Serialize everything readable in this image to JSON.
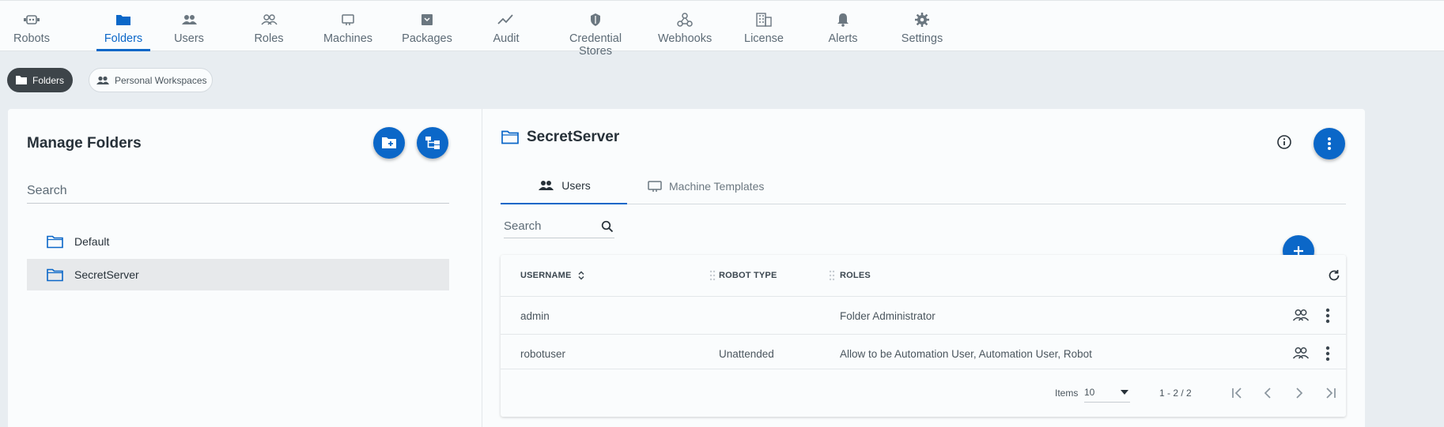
{
  "nav": [
    {
      "label": "Robots",
      "icon": "robot-icon"
    },
    {
      "label": "Folders",
      "icon": "folder-icon"
    },
    {
      "label": "Users",
      "icon": "users-icon"
    },
    {
      "label": "Roles",
      "icon": "roles-icon"
    },
    {
      "label": "Machines",
      "icon": "monitor-icon"
    },
    {
      "label": "Packages",
      "icon": "package-icon"
    },
    {
      "label": "Audit",
      "icon": "trend-icon"
    },
    {
      "label": "Credential Stores",
      "icon": "shield-icon"
    },
    {
      "label": "Webhooks",
      "icon": "webhook-icon"
    },
    {
      "label": "License",
      "icon": "building-icon"
    },
    {
      "label": "Alerts",
      "icon": "bell-icon"
    },
    {
      "label": "Settings",
      "icon": "gear-icon"
    }
  ],
  "chips": {
    "folders": "Folders",
    "personal": "Personal Workspaces"
  },
  "left": {
    "title": "Manage Folders",
    "search_placeholder": "Search",
    "folders": [
      "Default",
      "SecretServer"
    ]
  },
  "detail": {
    "title": "SecretServer",
    "tabs": [
      "Users",
      "Machine Templates"
    ],
    "search_placeholder": "Search",
    "columns": [
      "USERNAME",
      "ROBOT TYPE",
      "ROLES"
    ],
    "rows": [
      {
        "username": "admin",
        "robot_type": "",
        "roles": "Folder Administrator"
      },
      {
        "username": "robotuser",
        "robot_type": "Unattended",
        "roles": "Allow to be Automation User, Automation User, Robot"
      }
    ],
    "footer": {
      "items_label": "Items",
      "page_size": "10",
      "range": "1 - 2 / 2"
    }
  },
  "colors": {
    "accent": "#0b67c8",
    "background": "#e8edf1",
    "chip_active": "#3d4449"
  }
}
